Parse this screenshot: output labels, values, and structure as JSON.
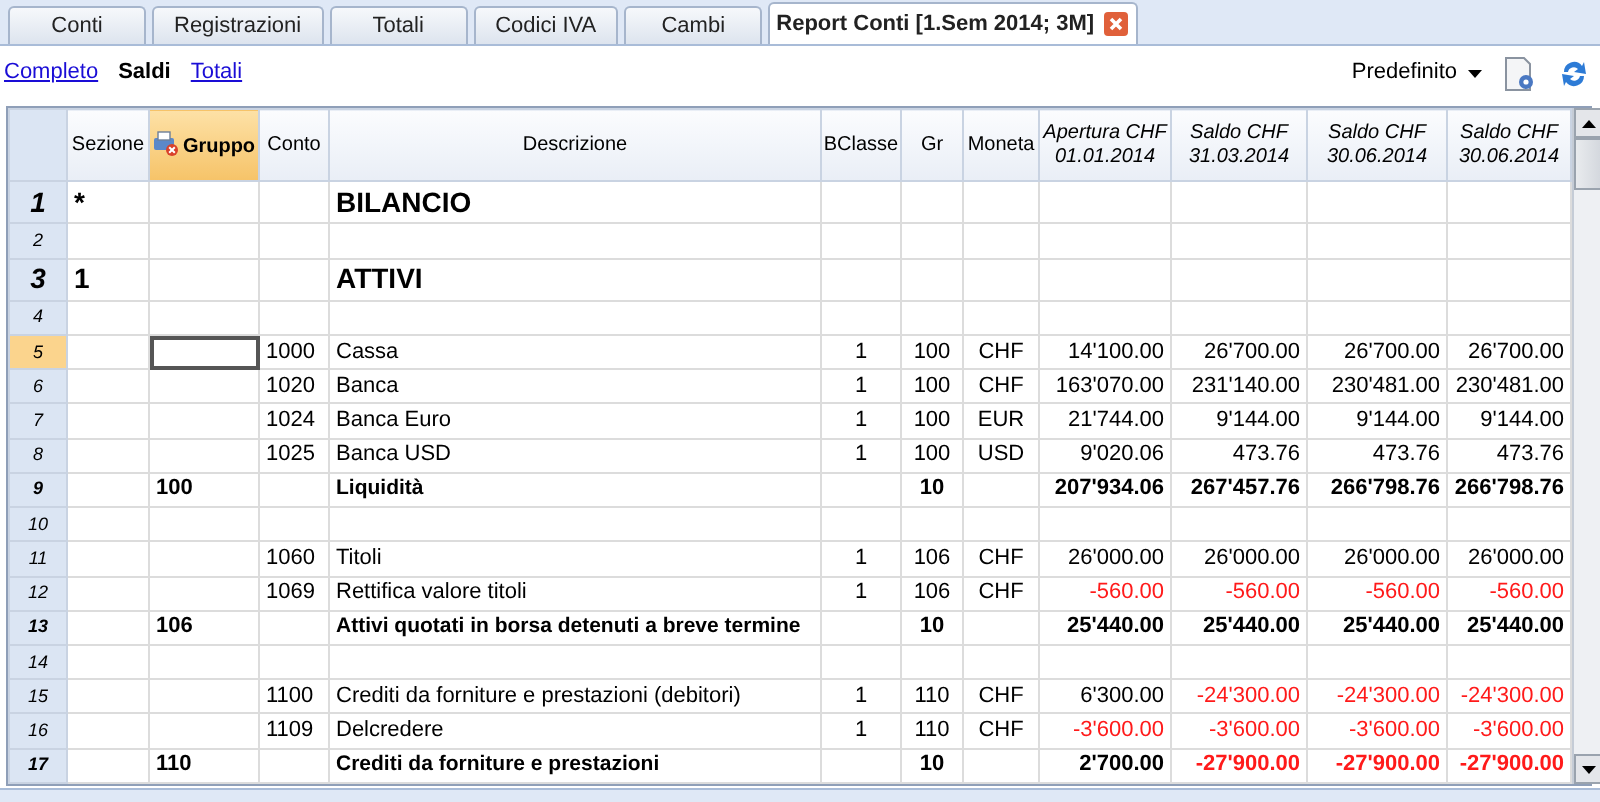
{
  "tabs": [
    {
      "label": "Conti",
      "selected": false,
      "closable": false
    },
    {
      "label": "Registrazioni",
      "selected": false,
      "closable": false
    },
    {
      "label": "Totali",
      "selected": false,
      "closable": false
    },
    {
      "label": "Codici IVA",
      "selected": false,
      "closable": false
    },
    {
      "label": "Cambi",
      "selected": false,
      "closable": false
    },
    {
      "label": "Report Conti [1.Sem 2014; 3M]",
      "selected": true,
      "closable": true
    }
  ],
  "views": [
    {
      "label": "Completo",
      "selected": false
    },
    {
      "label": "Saldi",
      "selected": true
    },
    {
      "label": "Totali",
      "selected": false
    }
  ],
  "layout_dropdown": {
    "label": "Predefinito"
  },
  "columns": [
    {
      "kind": "text",
      "lines": [
        "Sezione"
      ],
      "selected": false
    },
    {
      "kind": "text",
      "lines": [
        "Gruppo"
      ],
      "selected": true
    },
    {
      "kind": "text",
      "lines": [
        "Conto"
      ],
      "selected": false
    },
    {
      "kind": "description",
      "lines": [
        "Descrizione"
      ],
      "selected": false
    },
    {
      "kind": "center",
      "lines": [
        "BClasse"
      ],
      "selected": false
    },
    {
      "kind": "center",
      "lines": [
        "Gr"
      ],
      "selected": false
    },
    {
      "kind": "center",
      "lines": [
        "Moneta"
      ],
      "selected": false
    },
    {
      "kind": "amount",
      "lines": [
        "Apertura CHF",
        "01.01.2014"
      ],
      "selected": false
    },
    {
      "kind": "amount",
      "lines": [
        "Saldo CHF",
        "31.03.2014"
      ],
      "selected": false
    },
    {
      "kind": "amount",
      "lines": [
        "Saldo CHF",
        "30.06.2014"
      ],
      "selected": false
    },
    {
      "kind": "amount",
      "lines": [
        "Saldo CHF",
        "30.06.2014"
      ],
      "selected": false
    }
  ],
  "rows": [
    {
      "num": "1",
      "kind": "heading",
      "selected": false,
      "cells": [
        "*",
        null,
        null,
        "BILANCIO",
        null,
        null,
        null
      ]
    },
    {
      "num": "2",
      "kind": "blank",
      "selected": false
    },
    {
      "num": "3",
      "kind": "heading",
      "selected": false,
      "cells": [
        "1",
        null,
        null,
        "ATTIVI",
        null,
        null,
        null
      ]
    },
    {
      "num": "4",
      "kind": "blank",
      "selected": false
    },
    {
      "num": "5",
      "kind": "account",
      "selected": true,
      "cells": [
        null,
        null,
        "1000",
        "Cassa",
        "1",
        "100",
        "CHF"
      ],
      "amounts": [
        {
          "value": "14'100.00",
          "negative": false
        },
        {
          "value": "26'700.00",
          "negative": false
        },
        {
          "value": "26'700.00",
          "negative": false
        },
        {
          "value": "26'700.00",
          "negative": false
        }
      ]
    },
    {
      "num": "6",
      "kind": "account",
      "selected": false,
      "cells": [
        null,
        null,
        "1020",
        "Banca",
        "1",
        "100",
        "CHF"
      ],
      "amounts": [
        {
          "value": "163'070.00",
          "negative": false
        },
        {
          "value": "231'140.00",
          "negative": false
        },
        {
          "value": "230'481.00",
          "negative": false
        },
        {
          "value": "230'481.00",
          "negative": false
        }
      ]
    },
    {
      "num": "7",
      "kind": "account",
      "selected": false,
      "cells": [
        null,
        null,
        "1024",
        "Banca Euro",
        "1",
        "100",
        "EUR"
      ],
      "amounts": [
        {
          "value": "21'744.00",
          "negative": false
        },
        {
          "value": "9'144.00",
          "negative": false
        },
        {
          "value": "9'144.00",
          "negative": false
        },
        {
          "value": "9'144.00",
          "negative": false
        }
      ]
    },
    {
      "num": "8",
      "kind": "account",
      "selected": false,
      "cells": [
        null,
        null,
        "1025",
        "Banca USD",
        "1",
        "100",
        "USD"
      ],
      "amounts": [
        {
          "value": "9'020.06",
          "negative": false
        },
        {
          "value": "473.76",
          "negative": false
        },
        {
          "value": "473.76",
          "negative": false
        },
        {
          "value": "473.76",
          "negative": false
        }
      ]
    },
    {
      "num": "9",
      "kind": "total",
      "selected": false,
      "cells": [
        null,
        "100",
        null,
        "Liquidità",
        null,
        "10",
        null
      ],
      "amounts": [
        {
          "value": "207'934.06",
          "negative": false
        },
        {
          "value": "267'457.76",
          "negative": false
        },
        {
          "value": "266'798.76",
          "negative": false
        },
        {
          "value": "266'798.76",
          "negative": false
        }
      ]
    },
    {
      "num": "10",
      "kind": "blank",
      "selected": false
    },
    {
      "num": "11",
      "kind": "account",
      "selected": false,
      "cells": [
        null,
        null,
        "1060",
        "Titoli",
        "1",
        "106",
        "CHF"
      ],
      "amounts": [
        {
          "value": "26'000.00",
          "negative": false
        },
        {
          "value": "26'000.00",
          "negative": false
        },
        {
          "value": "26'000.00",
          "negative": false
        },
        {
          "value": "26'000.00",
          "negative": false
        }
      ]
    },
    {
      "num": "12",
      "kind": "account",
      "selected": false,
      "cells": [
        null,
        null,
        "1069",
        "Rettifica valore titoli",
        "1",
        "106",
        "CHF"
      ],
      "amounts": [
        {
          "value": "-560.00",
          "negative": true
        },
        {
          "value": "-560.00",
          "negative": true
        },
        {
          "value": "-560.00",
          "negative": true
        },
        {
          "value": "-560.00",
          "negative": true
        }
      ]
    },
    {
      "num": "13",
      "kind": "total",
      "selected": false,
      "cells": [
        null,
        "106",
        null,
        "Attivi quotati in borsa detenuti a breve termine",
        null,
        "10",
        null
      ],
      "amounts": [
        {
          "value": "25'440.00",
          "negative": false
        },
        {
          "value": "25'440.00",
          "negative": false
        },
        {
          "value": "25'440.00",
          "negative": false
        },
        {
          "value": "25'440.00",
          "negative": false
        }
      ]
    },
    {
      "num": "14",
      "kind": "blank",
      "selected": false
    },
    {
      "num": "15",
      "kind": "account",
      "selected": false,
      "cells": [
        null,
        null,
        "1100",
        "Crediti da forniture e prestazioni (debitori)",
        "1",
        "110",
        "CHF"
      ],
      "amounts": [
        {
          "value": "6'300.00",
          "negative": false
        },
        {
          "value": "-24'300.00",
          "negative": true
        },
        {
          "value": "-24'300.00",
          "negative": true
        },
        {
          "value": "-24'300.00",
          "negative": true
        }
      ]
    },
    {
      "num": "16",
      "kind": "account",
      "selected": false,
      "cells": [
        null,
        null,
        "1109",
        "Delcredere",
        "1",
        "110",
        "CHF"
      ],
      "amounts": [
        {
          "value": "-3'600.00",
          "negative": true
        },
        {
          "value": "-3'600.00",
          "negative": true
        },
        {
          "value": "-3'600.00",
          "negative": true
        },
        {
          "value": "-3'600.00",
          "negative": true
        }
      ]
    },
    {
      "num": "17",
      "kind": "total",
      "selected": false,
      "cells": [
        null,
        "110",
        null,
        "Crediti da forniture e prestazioni",
        null,
        "10",
        null
      ],
      "amounts": [
        {
          "value": "2'700.00",
          "negative": false
        },
        {
          "value": "-27'900.00",
          "negative": true
        },
        {
          "value": "-27'900.00",
          "negative": true
        },
        {
          "value": "-27'900.00",
          "negative": true
        }
      ]
    }
  ]
}
